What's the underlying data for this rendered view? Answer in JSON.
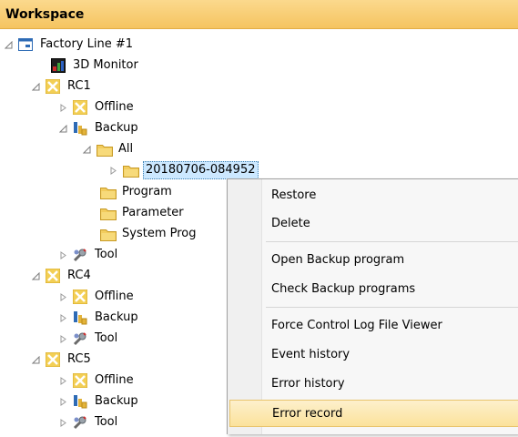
{
  "workspace": {
    "title": "Workspace"
  },
  "tree": {
    "factory": "Factory Line #1",
    "monitor": "3D Monitor",
    "rc1": {
      "label": "RC1",
      "offline": "Offline",
      "backup": "Backup",
      "all": "All",
      "backup_item": "20180706-084952",
      "program": "Program",
      "parameter": "Parameter",
      "system_prog": "System Prog",
      "tool": "Tool"
    },
    "rc4": {
      "label": "RC4",
      "offline": "Offline",
      "backup": "Backup",
      "tool": "Tool"
    },
    "rc5": {
      "label": "RC5",
      "offline": "Offline",
      "backup": "Backup",
      "tool": "Tool"
    }
  },
  "context_menu": {
    "items": [
      "Restore",
      "Delete",
      "Open Backup program",
      "Check Backup programs",
      "Force Control Log File Viewer",
      "Event history",
      "Error history",
      "Error record"
    ],
    "highlighted": "Error record"
  },
  "colors": {
    "titlebar": "#f5c460",
    "selection": "#cce8ff",
    "menu_highlight": "#fbe29b",
    "folder": "#f2cc5e"
  },
  "icons": {
    "factory": "factory-line-icon",
    "monitor": "3d-monitor-icon",
    "controller": "robot-controller-icon",
    "backup": "backup-icon",
    "folder": "folder-icon",
    "tool": "tool-icon"
  }
}
